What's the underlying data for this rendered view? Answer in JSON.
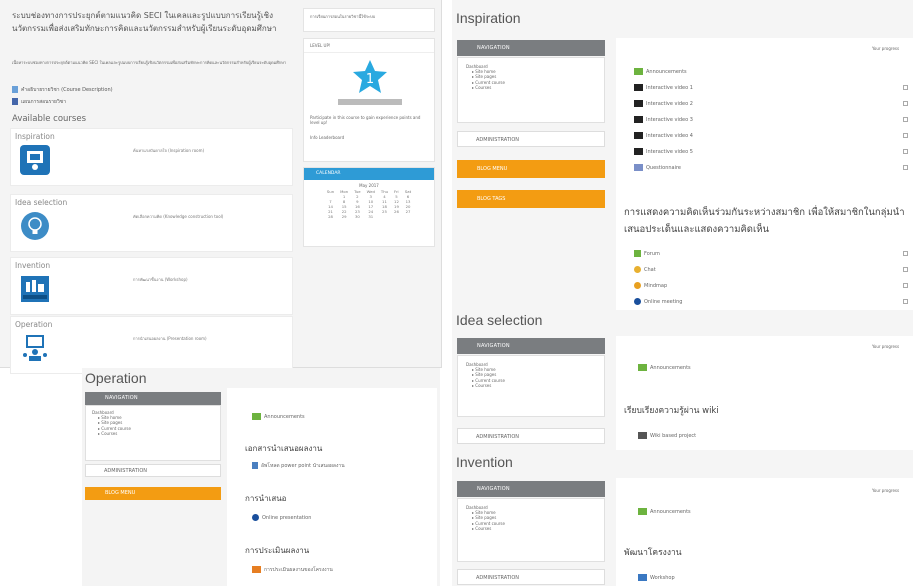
{
  "panel1": {
    "header": "ระบบช่องทางการประยุกต์ตามแนวคิด SECI ในเคลและรูปแบบการเรียนรู้เชิงนวัตกรรมเพื่อส่งเสริมทักษะการคิดและนวัตกรรมสำหรับผู้เรียนระดับอุดมศึกษา",
    "sub_text": "เนื้อหาระบบช่องทางการประยุกต์ตามแนวคิด SECI ในเคลและรูปแบบการเรียนรู้เชิงนวัตกรรมเพื่อส่งเสริมทักษะการคิดและนวัตกรรมสำหรับผู้เรียนระดับอุดมศึกษา",
    "links": [
      "คำอธิบายรายวิชา (Course Description)",
      "แผนการสอนรายวิชา"
    ],
    "available_courses": "Available courses",
    "courses": [
      {
        "name": "Inspiration",
        "desc": "ค้นหาแรงบันดาลใจ (Inspiration room)"
      },
      {
        "name": "Idea selection",
        "desc": "คัดเลือกความคิด (Knowledge construction tool)"
      },
      {
        "name": "Invention",
        "desc": "การพัฒนาชิ้นงาน (Workshop)"
      },
      {
        "name": "Operation",
        "desc": "การนำเสนอผลงาน (Presentation room)"
      }
    ],
    "side_top": "การเรียนการสอนในรายวิชานี้ใช้ระบบ",
    "level_up": "LEVEL UP!",
    "level_num": "1",
    "level_text": "Participate in this course to gain experience points and level up!",
    "level_links": "Info  Leaderboard",
    "calendar_title": "CALENDAR",
    "calendar_month": "May 2017",
    "calendar_days": [
      "Sun",
      "Mon",
      "Tue",
      "Wed",
      "Thu",
      "Fri",
      "Sat"
    ],
    "calendar_rows": [
      [
        "",
        "1",
        "2",
        "3",
        "4",
        "5",
        "6"
      ],
      [
        "7",
        "8",
        "9",
        "10",
        "11",
        "12",
        "13"
      ],
      [
        "14",
        "15",
        "16",
        "17",
        "18",
        "19",
        "20"
      ],
      [
        "21",
        "22",
        "23",
        "24",
        "25",
        "26",
        "27"
      ],
      [
        "28",
        "29",
        "30",
        "31",
        "",
        "",
        ""
      ]
    ]
  },
  "inspiration": {
    "title": "Inspiration",
    "nav_head": "NAVIGATION",
    "nav_items": [
      "Dashboard",
      "Site home",
      "Site pages",
      "Current course",
      "Courses"
    ],
    "admin": "ADMINISTRATION",
    "blog_menu": "BLOG MENU",
    "blog_tags": "BLOG TAGS",
    "progress": "Your progress",
    "items": [
      "Announcements",
      "Interactive video 1",
      "Interactive video 2",
      "Interactive video 3",
      "Interactive video 4",
      "Interactive video 5",
      "Questionnaire"
    ],
    "thai_heading": "การแสดงความคิดเห็นร่วมกันระหว่างสมาชิก เพื่อให้สมาชิกในกลุ่มนำเสนอประเด็นและแสดงความคิดเห็น",
    "items2": [
      "Forum",
      "Chat",
      "Mindmap",
      "Online meeting"
    ]
  },
  "idea": {
    "title": "Idea selection",
    "nav_head": "NAVIGATION",
    "nav_items": [
      "Dashboard",
      "Site home",
      "Site pages",
      "Current course",
      "Courses"
    ],
    "admin": "ADMINISTRATION",
    "progress": "Your progress",
    "announcements": "Announcements",
    "thai_heading": "เรียบเรียงความรู้ผ่าน wiki",
    "wiki": "Wiki based project"
  },
  "invention": {
    "title": "Invention",
    "nav_head": "NAVIGATION",
    "nav_items": [
      "Dashboard",
      "Site home",
      "Site pages",
      "Current course",
      "Courses"
    ],
    "admin": "ADMINISTRATION",
    "progress": "Your progress",
    "announcements": "Announcements",
    "thai_heading": "พัฒนาโครงงาน",
    "workshop": "Workshop"
  },
  "operation": {
    "title": "Operation",
    "nav_head": "NAVIGATION",
    "nav_items": [
      "Dashboard",
      "Site home",
      "Site pages",
      "Current course",
      "Courses"
    ],
    "admin": "ADMINISTRATION",
    "blog_menu": "BLOG MENU",
    "announcements": "Announcements",
    "h1": "เอกสารนำเสนอผลงาน",
    "doc": "อัพโหลด power point นำเสนอผลงาน",
    "h2": "การนำเสนอ",
    "online": "Online presentation",
    "h3": "การประเมินผลงาน",
    "eval": "การประเมินผลงานของโครงงาน"
  },
  "colors": {
    "nav": "#7a7d80",
    "orange": "#f39c12",
    "calendar": "#2e9bd6",
    "star": "#29a9e0"
  }
}
